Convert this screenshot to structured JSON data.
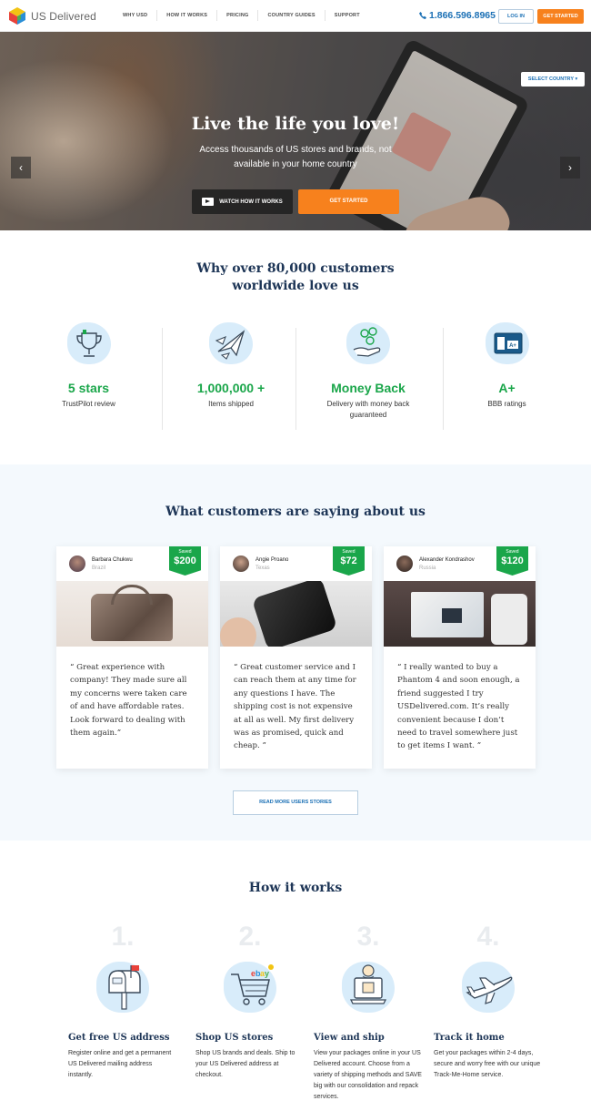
{
  "header": {
    "logo_text": "US Delivered",
    "nav": [
      "WHY USD",
      "HOW IT WORKS",
      "PRICING",
      "COUNTRY GUIDES",
      "SUPPORT"
    ],
    "phone": "1.866.596.8965",
    "login": "LOG IN",
    "get_started": "GET STARTED",
    "phone_icon": "phone-icon"
  },
  "hero": {
    "select_country": "SELECT COUNTRY",
    "title": "Live the life you love!",
    "subtitle": "Access thousands of US stores and brands, not available in your home country",
    "watch": "WATCH HOW IT WORKS",
    "get_started": "GET STARTED",
    "prev": "‹",
    "next": "›"
  },
  "why": {
    "title": "Why over 80,000 customers worldwide love us",
    "stats": [
      {
        "big": "5 stars",
        "small": "TrustPilot review",
        "icon": "trophy-icon"
      },
      {
        "big": "1,000,000 +",
        "small": "Items shipped",
        "icon": "paper-planes-icon"
      },
      {
        "big": "Money Back",
        "small": "Delivery with money back guaranteed",
        "icon": "money-hand-icon"
      },
      {
        "big": "A+",
        "small": "BBB ratings",
        "icon": "bbb-icon"
      }
    ]
  },
  "testimonials": {
    "title": "What customers are saying about us",
    "saved_label": "Saved",
    "cards": [
      {
        "name": "Barbara Chukwu",
        "location": "Brazil",
        "saved": "$200",
        "quote": "“ Great experience with company! They made sure all my concerns were taken care of and have affordable rates. Look forward to dealing with them again.”"
      },
      {
        "name": "Angie Proano",
        "location": "Texas",
        "saved": "$72",
        "quote": "“ Great customer service and I can reach them at any time for any questions I have. The shipping cost is not expensive at all as well. My first delivery was as promised, quick and cheap. ”"
      },
      {
        "name": "Alexander Kondrashov",
        "location": "Russia",
        "saved": "$120",
        "quote": "“ I really wanted to buy a Phantom 4 and soon enough, a friend suggested I try USDelivered.com. It’s really convenient because I don’t need to travel somewhere just to get items I want. ”"
      }
    ],
    "read_more": "READ MORE USERS STORIES"
  },
  "how": {
    "title": "How it works",
    "steps": [
      {
        "num": "1.",
        "title": "Get free US address",
        "desc": "Register online and get a permanent US Delivered mailing address instantly.",
        "icon": "mailbox-icon"
      },
      {
        "num": "2.",
        "title": "Shop US stores",
        "desc": "Shop US brands and deals. Ship to your US Delivered address at checkout.",
        "icon": "shopping-cart-icon"
      },
      {
        "num": "3.",
        "title": "View and ship",
        "desc": "View your packages online in your US Delivered account. Choose from a variety of shipping methods and SAVE big with our consolidation and repack services.",
        "icon": "laptop-package-icon"
      },
      {
        "num": "4.",
        "title": "Track it home",
        "desc": "Get your packages within 2-4 days, secure and worry free with our unique Track-Me-Home service.",
        "icon": "airplane-icon"
      }
    ]
  },
  "colors": {
    "accent": "#f7811d",
    "brand_blue": "#1b70b5",
    "green": "#1aa64a",
    "navy": "#1d3556"
  }
}
